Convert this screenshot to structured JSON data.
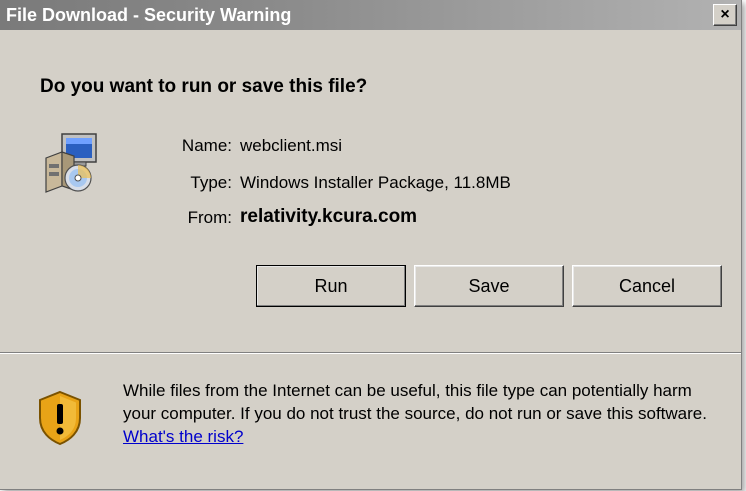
{
  "window": {
    "title": "File Download - Security Warning",
    "close_label": "×"
  },
  "dialog": {
    "question": "Do you want to run or save this file?",
    "fields": [
      {
        "label": "Name:",
        "value": "webclient.msi"
      },
      {
        "label": "Type:",
        "value": "Windows Installer Package, 11.8MB"
      },
      {
        "label": "From:",
        "value": "relativity.kcura.com"
      }
    ],
    "buttons": {
      "run": "Run",
      "save": "Save",
      "cancel": "Cancel"
    },
    "warning_text": "While files from the Internet can be useful, this file type can potentially harm your computer. If you do not trust the source, do not run or save this software.",
    "risk_link": "What's the risk?"
  },
  "icons": {
    "package": "installer-package-icon",
    "shield": "warning-shield-icon"
  },
  "colors": {
    "window_bg": "#d4d0c8",
    "titlebar": "#8c8c8c",
    "link": "#0000cc",
    "shield": "#e8a317"
  }
}
